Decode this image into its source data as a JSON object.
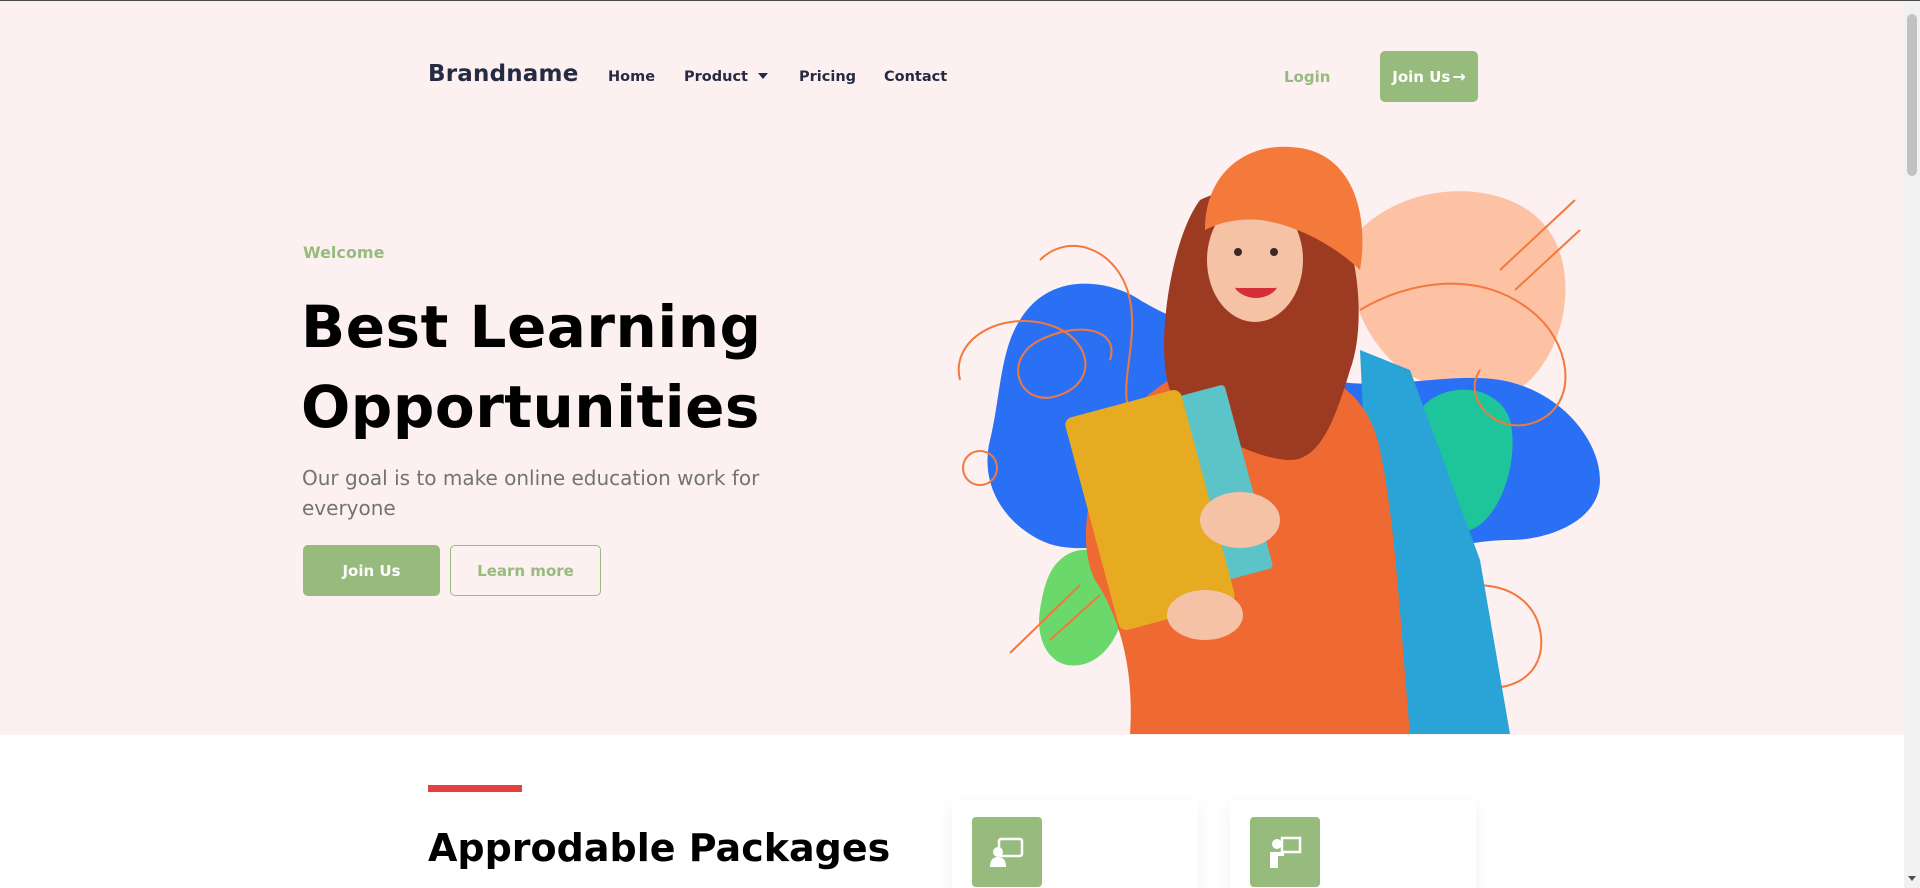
{
  "nav": {
    "brand": "Brandname",
    "items": [
      {
        "label": "Home"
      },
      {
        "label": "Product"
      },
      {
        "label": "Pricing"
      },
      {
        "label": "Contact"
      }
    ],
    "login_label": "Login",
    "join_label": "Join Us"
  },
  "hero": {
    "welcome": "Welcome",
    "headline_line1": "Best Learning",
    "headline_line2": "Opportunities",
    "subtext": "Our goal is to make online education work for everyone",
    "join_button": "Join Us",
    "learn_button": "Learn more"
  },
  "packages": {
    "title": "Approdable Packages"
  },
  "colors": {
    "accent": "#96bb7c",
    "hero_bg": "#fdf0f0",
    "heading": "#252b42",
    "muted": "#737373",
    "red": "#e74040"
  }
}
